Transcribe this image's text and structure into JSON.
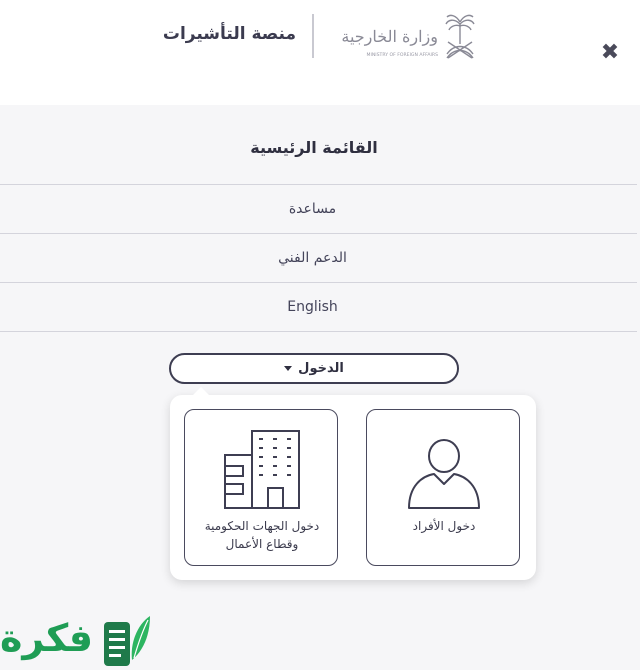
{
  "header": {
    "platform_title": "منصة التأشيرات",
    "ministry_name": "وزارة الخارجية",
    "ministry_name_en": "MINISTRY OF FOREIGN AFFAIRS",
    "close_symbol": "✖"
  },
  "menu": {
    "title": "القائمة الرئيسية",
    "items": [
      {
        "label": "مساعدة"
      },
      {
        "label": "الدعم الفني"
      },
      {
        "label": "English"
      }
    ]
  },
  "login": {
    "button_label": "الدخول",
    "options": {
      "individuals": "دخول الأفراد",
      "business_line1": "دخول الجهات الحكومية",
      "business_line2": "وقطاع الأعمال"
    }
  },
  "watermark": {
    "text": "فكرة"
  },
  "colors": {
    "accent": "#3e3e52",
    "panel_bg": "#f6f6f8",
    "watermark_green": "#1f9d55"
  }
}
